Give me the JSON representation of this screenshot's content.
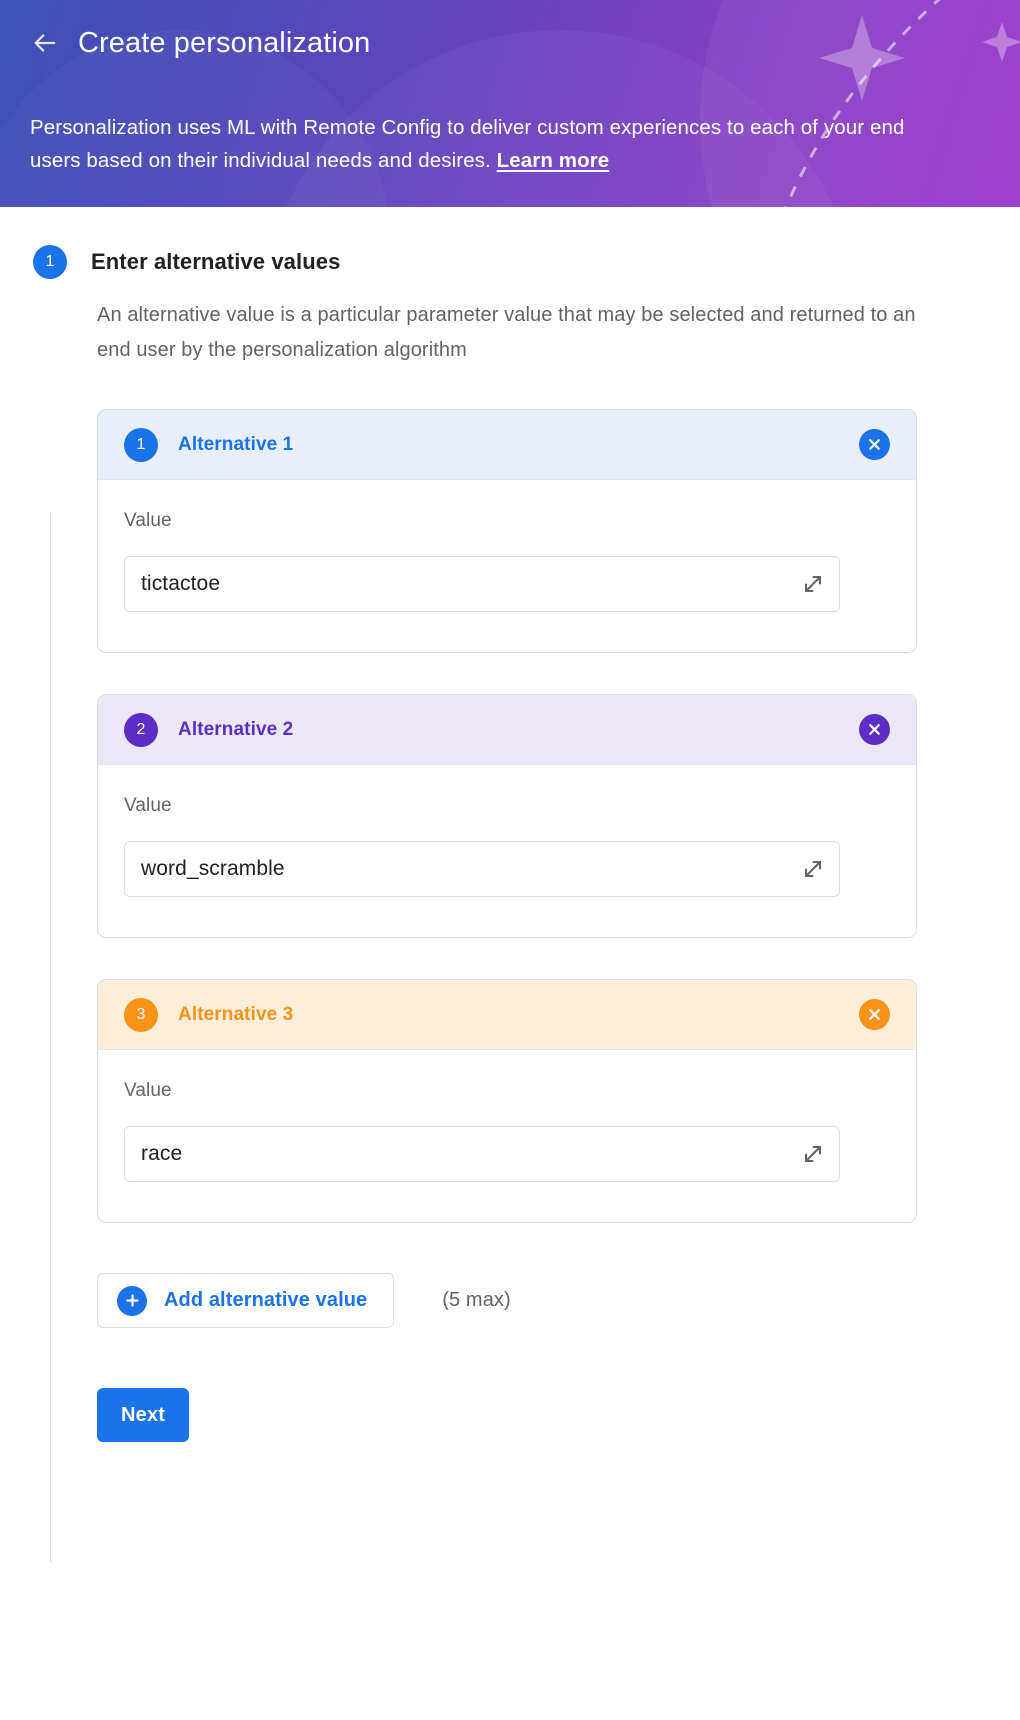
{
  "header": {
    "back_icon": "arrow-left-icon",
    "title": "Create personalization",
    "description_before_link": "Personalization uses ML with Remote Config to deliver custom experiences to each of your end users based on their individual needs and desires. ",
    "link_label": "Learn more",
    "gradient_start": "#3f51b5",
    "gradient_end": "#9b34c8"
  },
  "step": {
    "number": "1",
    "title": "Enter alternative values",
    "description": "An alternative value is a particular parameter value that may be selected and returned to an end user by the personalization algorithm",
    "badge_color": "#1a73e8"
  },
  "alternatives": [
    {
      "number": "1",
      "label": "Alternative 1",
      "value_label": "Value",
      "value": "tictactoe",
      "accent": "#1a73e8",
      "header_bg": "#e8eefc",
      "close_icon": "close-circle-icon",
      "expand_icon": "expand-diagonal-icon"
    },
    {
      "number": "2",
      "label": "Alternative 2",
      "value_label": "Value",
      "value": "word_scramble",
      "accent": "#5b2ec4",
      "header_bg": "#ece7f6",
      "close_icon": "close-circle-icon",
      "expand_icon": "expand-diagonal-icon"
    },
    {
      "number": "3",
      "label": "Alternative 3",
      "value_label": "Value",
      "value": "race",
      "accent": "#f99219",
      "header_bg": "#fdeed9",
      "close_icon": "close-circle-icon",
      "expand_icon": "expand-diagonal-icon"
    }
  ],
  "add_row": {
    "plus_icon": "plus-circle-icon",
    "button_label": "Add alternative value",
    "max_note": "(5 max)"
  },
  "footer": {
    "next_label": "Next"
  }
}
